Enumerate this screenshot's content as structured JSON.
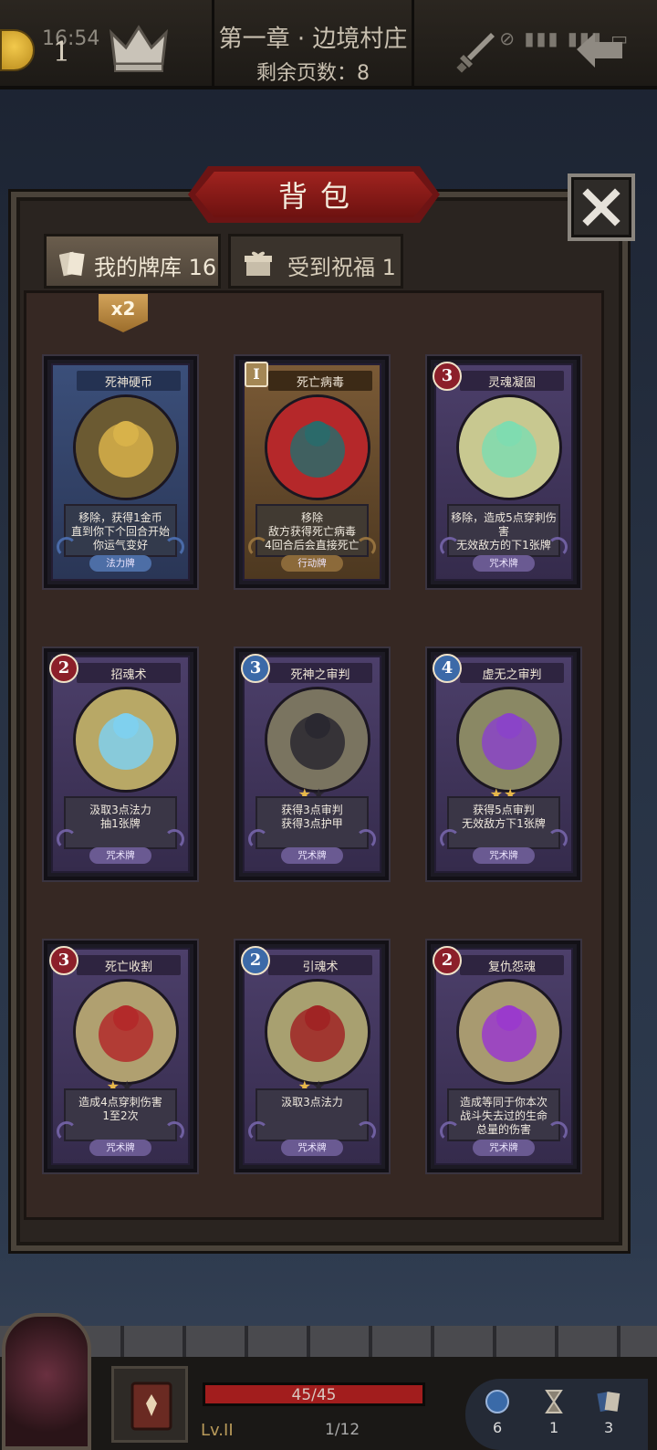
{
  "status_bar": {
    "time": "16:54",
    "icons": "⊘ ▮▮▮ ▮▮▮ ▭"
  },
  "header": {
    "coin_count": "1",
    "chapter_title": "第一章 · 边境村庄",
    "pages_left": "剩余页数：8"
  },
  "panel": {
    "title": "背包",
    "tabs": [
      {
        "label": "我的牌库 16"
      },
      {
        "label": "受到祝福 1"
      }
    ],
    "duplicate_badge": "x2"
  },
  "cards": [
    {
      "name": "死神硬币",
      "cost": "",
      "cost_style": "none",
      "frame": "blue",
      "stars": 0,
      "stars_max": 0,
      "desc": "移除，获得1金币\n直到你下个回合开始\n你运气变好",
      "type": "法力牌",
      "art": {
        "bg": "#6b5a32",
        "fg": "#d8b24a"
      }
    },
    {
      "name": "死亡病毒",
      "cost": "I",
      "cost_style": "hourglass",
      "frame": "brown",
      "stars": 0,
      "stars_max": 0,
      "desc": "移除\n敌方获得死亡病毒\n4回合后会直接死亡",
      "type": "行动牌",
      "art": {
        "bg": "#b5282a",
        "fg": "#2b6a6a"
      }
    },
    {
      "name": "灵魂凝固",
      "cost": "3",
      "cost_style": "red",
      "frame": "purple",
      "stars": 0,
      "stars_max": 0,
      "desc": "移除，造成5点穿刺伤害\n无效敌方的下1张牌",
      "type": "咒术牌",
      "art": {
        "bg": "#c8c890",
        "fg": "#7fdcb0"
      }
    },
    {
      "name": "招魂术",
      "cost": "2",
      "cost_style": "red",
      "frame": "purple",
      "stars": 0,
      "stars_max": 0,
      "desc": "汲取3点法力\n抽1张牌",
      "type": "咒术牌",
      "art": {
        "bg": "#b8a866",
        "fg": "#7fd0ee"
      }
    },
    {
      "name": "死神之审判",
      "cost": "3",
      "cost_style": "blue",
      "frame": "purple",
      "stars": 1,
      "stars_max": 2,
      "desc": "获得3点审判\n获得3点护甲",
      "type": "咒术牌",
      "art": {
        "bg": "#7a7460",
        "fg": "#2a2830"
      }
    },
    {
      "name": "虚无之审判",
      "cost": "4",
      "cost_style": "blue",
      "frame": "purple",
      "stars": 2,
      "stars_max": 2,
      "desc": "获得5点审判\n无效敌方下1张牌",
      "type": "咒术牌",
      "art": {
        "bg": "#8a8864",
        "fg": "#8a44c8"
      }
    },
    {
      "name": "死亡收割",
      "cost": "3",
      "cost_style": "red",
      "frame": "purple",
      "stars": 1,
      "stars_max": 2,
      "desc": "造成4点穿刺伤害\n1至2次",
      "type": "咒术牌",
      "art": {
        "bg": "#b0a070",
        "fg": "#b32a2a"
      }
    },
    {
      "name": "引魂术",
      "cost": "2",
      "cost_style": "blue",
      "frame": "purple",
      "stars": 1,
      "stars_max": 2,
      "desc": "汲取3点法力",
      "type": "咒术牌",
      "art": {
        "bg": "#a8a070",
        "fg": "#a02424"
      }
    },
    {
      "name": "复仇怨魂",
      "cost": "2",
      "cost_style": "red",
      "frame": "purple",
      "stars": 0,
      "stars_max": 0,
      "desc": "造成等同于你本次\n战斗失去过的生命\n总量的伤害",
      "type": "咒术牌",
      "art": {
        "bg": "#a89a70",
        "fg": "#9a3acc"
      }
    }
  ],
  "footer": {
    "hp_text": "45/45",
    "hp_fraction": 1.0,
    "level_text": "Lv.II",
    "pages_text": "1/12",
    "counters": [
      "6",
      "1",
      "3"
    ]
  },
  "colors": {
    "accent_red": "#a0231f",
    "star": "#e8b84a",
    "purple_pill": "#6a5a92"
  }
}
